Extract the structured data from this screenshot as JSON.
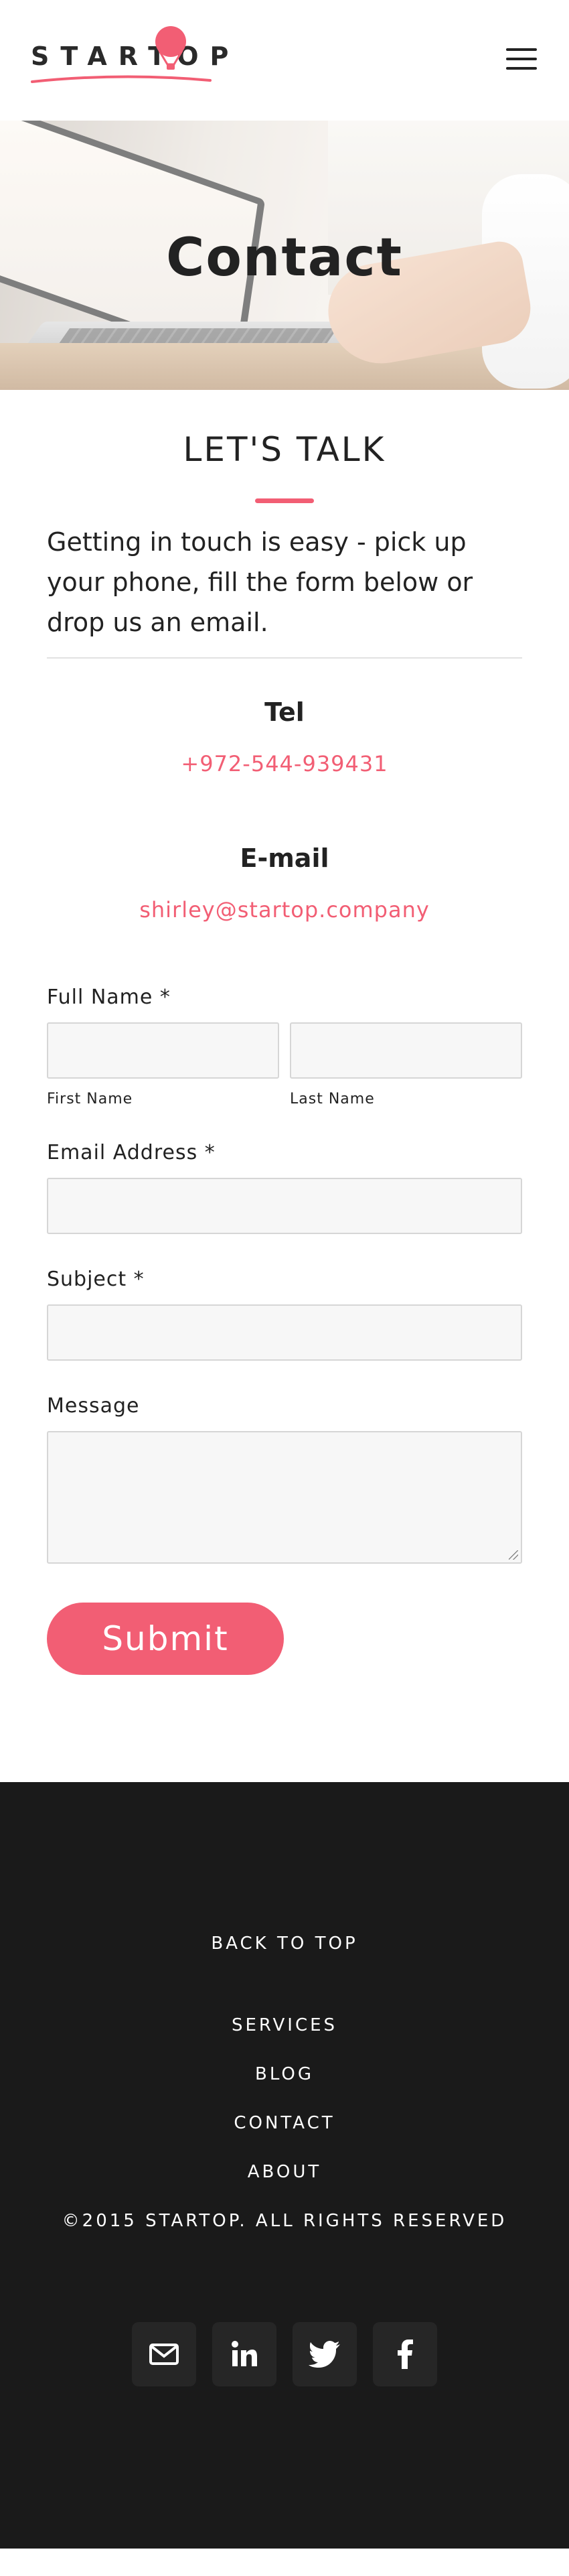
{
  "header": {
    "logo_text": "STARTOP",
    "brand_color": "#f25e74",
    "menu_icon": "hamburger-menu-icon"
  },
  "hero": {
    "title": "Contact"
  },
  "contact": {
    "heading": "LET'S TALK",
    "intro": "Getting in touch is easy - pick up your phone, fill the form below or drop us an email.",
    "tel_label": "Tel",
    "tel_value": "+972-544-939431",
    "email_label": "E-mail",
    "email_value": "shirley@startop.company"
  },
  "form": {
    "full_name_label": "Full Name *",
    "first_name_label": "First Name",
    "last_name_label": "Last Name",
    "email_label": "Email Address *",
    "subject_label": "Subject *",
    "message_label": "Message",
    "submit_label": "Submit",
    "first_name_value": "",
    "last_name_value": "",
    "email_value": "",
    "subject_value": "",
    "message_value": ""
  },
  "footer": {
    "back_to_top": "BACK TO TOP",
    "links": [
      "SERVICES",
      "BLOG",
      "CONTACT",
      "ABOUT"
    ],
    "copyright": "©2015 STARTOP. ALL RIGHTS RESERVED",
    "social": [
      "email-icon",
      "linkedin-icon",
      "twitter-icon",
      "facebook-icon"
    ],
    "background": "#1a1a1a"
  }
}
